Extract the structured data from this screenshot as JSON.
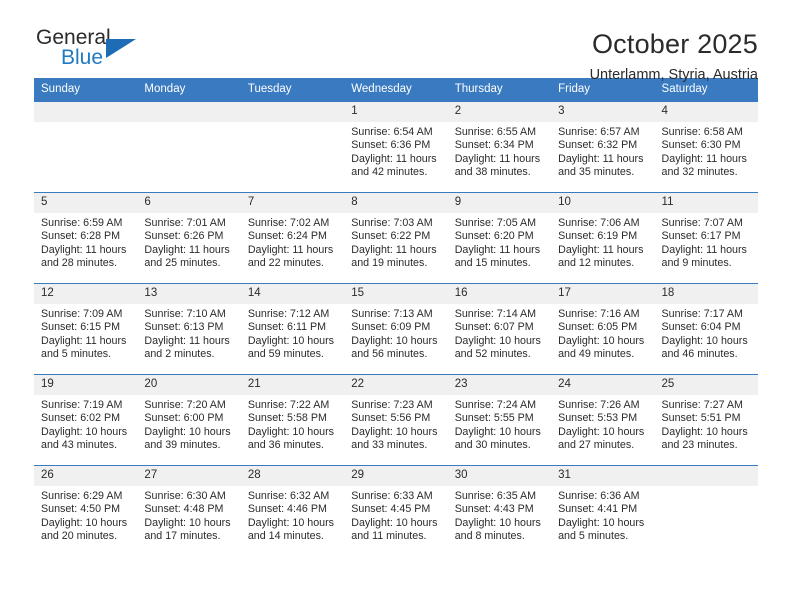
{
  "brand": {
    "name_part1": "General",
    "name_part2": "Blue",
    "accent_color": "#1d6cb5"
  },
  "header": {
    "title": "October 2025",
    "location": "Unterlamm, Styria, Austria"
  },
  "theme": {
    "header_row_color": "#3a7ac0",
    "date_band_color": "#f0f0f0",
    "text_color": "#2b2b2b"
  },
  "weekday_headers": [
    "Sunday",
    "Monday",
    "Tuesday",
    "Wednesday",
    "Thursday",
    "Friday",
    "Saturday"
  ],
  "labels": {
    "sunrise": "Sunrise:",
    "sunset": "Sunset:",
    "daylight": "Daylight:"
  },
  "weeks": [
    [
      {
        "day": "",
        "empty": true
      },
      {
        "day": "",
        "empty": true
      },
      {
        "day": "",
        "empty": true
      },
      {
        "day": "1",
        "sunrise": "Sunrise: 6:54 AM",
        "sunset": "Sunset: 6:36 PM",
        "daylight": "Daylight: 11 hours and 42 minutes."
      },
      {
        "day": "2",
        "sunrise": "Sunrise: 6:55 AM",
        "sunset": "Sunset: 6:34 PM",
        "daylight": "Daylight: 11 hours and 38 minutes."
      },
      {
        "day": "3",
        "sunrise": "Sunrise: 6:57 AM",
        "sunset": "Sunset: 6:32 PM",
        "daylight": "Daylight: 11 hours and 35 minutes."
      },
      {
        "day": "4",
        "sunrise": "Sunrise: 6:58 AM",
        "sunset": "Sunset: 6:30 PM",
        "daylight": "Daylight: 11 hours and 32 minutes."
      }
    ],
    [
      {
        "day": "5",
        "sunrise": "Sunrise: 6:59 AM",
        "sunset": "Sunset: 6:28 PM",
        "daylight": "Daylight: 11 hours and 28 minutes."
      },
      {
        "day": "6",
        "sunrise": "Sunrise: 7:01 AM",
        "sunset": "Sunset: 6:26 PM",
        "daylight": "Daylight: 11 hours and 25 minutes."
      },
      {
        "day": "7",
        "sunrise": "Sunrise: 7:02 AM",
        "sunset": "Sunset: 6:24 PM",
        "daylight": "Daylight: 11 hours and 22 minutes."
      },
      {
        "day": "8",
        "sunrise": "Sunrise: 7:03 AM",
        "sunset": "Sunset: 6:22 PM",
        "daylight": "Daylight: 11 hours and 19 minutes."
      },
      {
        "day": "9",
        "sunrise": "Sunrise: 7:05 AM",
        "sunset": "Sunset: 6:20 PM",
        "daylight": "Daylight: 11 hours and 15 minutes."
      },
      {
        "day": "10",
        "sunrise": "Sunrise: 7:06 AM",
        "sunset": "Sunset: 6:19 PM",
        "daylight": "Daylight: 11 hours and 12 minutes."
      },
      {
        "day": "11",
        "sunrise": "Sunrise: 7:07 AM",
        "sunset": "Sunset: 6:17 PM",
        "daylight": "Daylight: 11 hours and 9 minutes."
      }
    ],
    [
      {
        "day": "12",
        "sunrise": "Sunrise: 7:09 AM",
        "sunset": "Sunset: 6:15 PM",
        "daylight": "Daylight: 11 hours and 5 minutes."
      },
      {
        "day": "13",
        "sunrise": "Sunrise: 7:10 AM",
        "sunset": "Sunset: 6:13 PM",
        "daylight": "Daylight: 11 hours and 2 minutes."
      },
      {
        "day": "14",
        "sunrise": "Sunrise: 7:12 AM",
        "sunset": "Sunset: 6:11 PM",
        "daylight": "Daylight: 10 hours and 59 minutes."
      },
      {
        "day": "15",
        "sunrise": "Sunrise: 7:13 AM",
        "sunset": "Sunset: 6:09 PM",
        "daylight": "Daylight: 10 hours and 56 minutes."
      },
      {
        "day": "16",
        "sunrise": "Sunrise: 7:14 AM",
        "sunset": "Sunset: 6:07 PM",
        "daylight": "Daylight: 10 hours and 52 minutes."
      },
      {
        "day": "17",
        "sunrise": "Sunrise: 7:16 AM",
        "sunset": "Sunset: 6:05 PM",
        "daylight": "Daylight: 10 hours and 49 minutes."
      },
      {
        "day": "18",
        "sunrise": "Sunrise: 7:17 AM",
        "sunset": "Sunset: 6:04 PM",
        "daylight": "Daylight: 10 hours and 46 minutes."
      }
    ],
    [
      {
        "day": "19",
        "sunrise": "Sunrise: 7:19 AM",
        "sunset": "Sunset: 6:02 PM",
        "daylight": "Daylight: 10 hours and 43 minutes."
      },
      {
        "day": "20",
        "sunrise": "Sunrise: 7:20 AM",
        "sunset": "Sunset: 6:00 PM",
        "daylight": "Daylight: 10 hours and 39 minutes."
      },
      {
        "day": "21",
        "sunrise": "Sunrise: 7:22 AM",
        "sunset": "Sunset: 5:58 PM",
        "daylight": "Daylight: 10 hours and 36 minutes."
      },
      {
        "day": "22",
        "sunrise": "Sunrise: 7:23 AM",
        "sunset": "Sunset: 5:56 PM",
        "daylight": "Daylight: 10 hours and 33 minutes."
      },
      {
        "day": "23",
        "sunrise": "Sunrise: 7:24 AM",
        "sunset": "Sunset: 5:55 PM",
        "daylight": "Daylight: 10 hours and 30 minutes."
      },
      {
        "day": "24",
        "sunrise": "Sunrise: 7:26 AM",
        "sunset": "Sunset: 5:53 PM",
        "daylight": "Daylight: 10 hours and 27 minutes."
      },
      {
        "day": "25",
        "sunrise": "Sunrise: 7:27 AM",
        "sunset": "Sunset: 5:51 PM",
        "daylight": "Daylight: 10 hours and 23 minutes."
      }
    ],
    [
      {
        "day": "26",
        "sunrise": "Sunrise: 6:29 AM",
        "sunset": "Sunset: 4:50 PM",
        "daylight": "Daylight: 10 hours and 20 minutes."
      },
      {
        "day": "27",
        "sunrise": "Sunrise: 6:30 AM",
        "sunset": "Sunset: 4:48 PM",
        "daylight": "Daylight: 10 hours and 17 minutes."
      },
      {
        "day": "28",
        "sunrise": "Sunrise: 6:32 AM",
        "sunset": "Sunset: 4:46 PM",
        "daylight": "Daylight: 10 hours and 14 minutes."
      },
      {
        "day": "29",
        "sunrise": "Sunrise: 6:33 AM",
        "sunset": "Sunset: 4:45 PM",
        "daylight": "Daylight: 10 hours and 11 minutes."
      },
      {
        "day": "30",
        "sunrise": "Sunrise: 6:35 AM",
        "sunset": "Sunset: 4:43 PM",
        "daylight": "Daylight: 10 hours and 8 minutes."
      },
      {
        "day": "31",
        "sunrise": "Sunrise: 6:36 AM",
        "sunset": "Sunset: 4:41 PM",
        "daylight": "Daylight: 10 hours and 5 minutes."
      },
      {
        "day": "",
        "empty": true
      }
    ]
  ]
}
